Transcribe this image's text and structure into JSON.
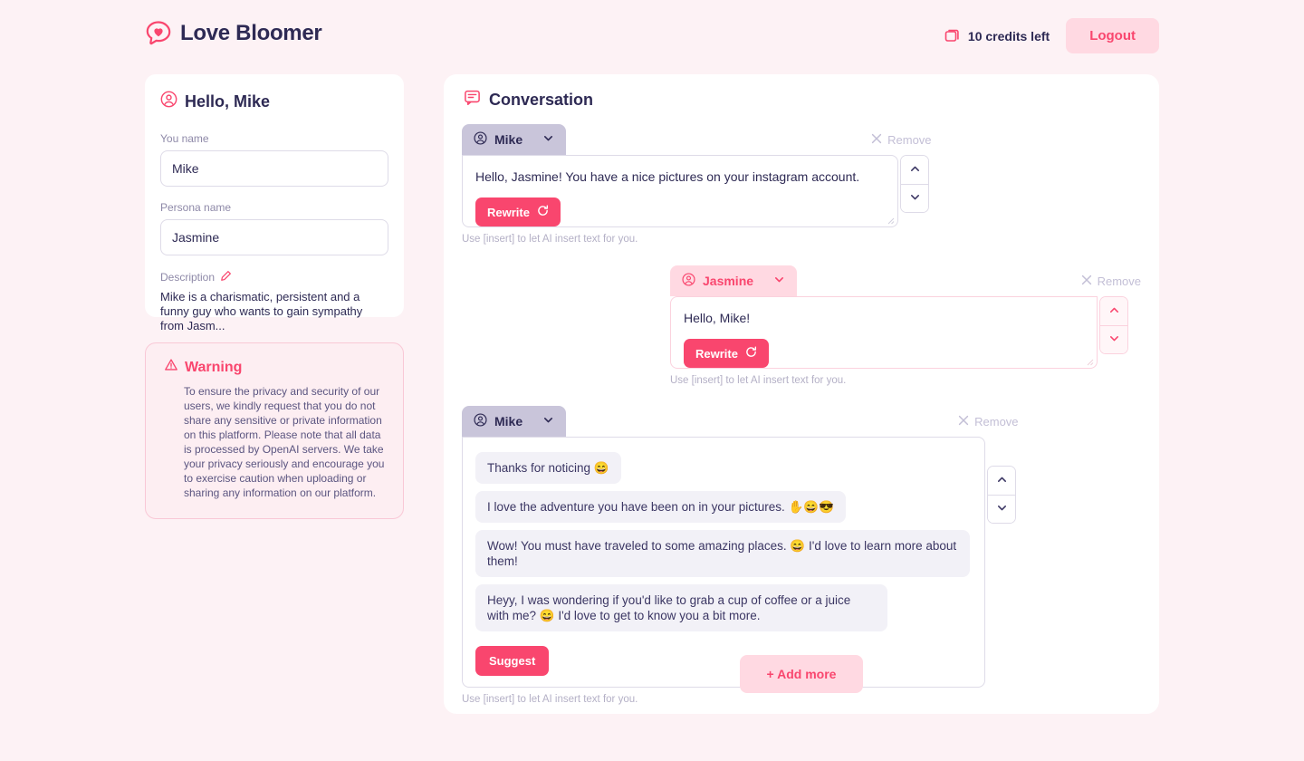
{
  "brand": {
    "name": "Love Bloomer",
    "logo_icon": "heart-speech-bubble-icon"
  },
  "header": {
    "credits_icon": "credits-card-icon",
    "credits_text": "10 credits left",
    "logout_label": "Logout"
  },
  "sidebar": {
    "profile": {
      "user_icon": "user-circle-icon",
      "greeting": "Hello, Mike",
      "you_name_label": "You name",
      "you_name_value": "Mike",
      "persona_name_label": "Persona name",
      "persona_name_value": "Jasmine",
      "description_label": "Description",
      "description_edit_icon": "pencil-icon",
      "description_value": "Mike is a charismatic, persistent and a funny guy who wants to gain sympathy from Jasm..."
    },
    "warning": {
      "icon": "alert-triangle-icon",
      "title": "Warning",
      "body": "To ensure the privacy and security of our users, we kindly request that you do not share any sensitive or private information on this platform. Please note that all data is processed by OpenAI servers. We take your privacy seriously and encourage you to exercise caution when uploading or sharing any information on our platform."
    }
  },
  "conversation": {
    "icon": "chat-bubble-icon",
    "title": "Conversation",
    "hint": "Use [insert] to let AI insert text for you.",
    "remove_label": "Remove",
    "remove_icon": "close-x-icon",
    "rewrite_label": "Rewrite",
    "rewrite_icon": "refresh-icon",
    "suggest_label": "Suggest",
    "caret_icon": "chevron-down-icon",
    "move_up_icon": "chevron-up-icon",
    "move_down_icon": "chevron-down-icon",
    "add_more_label": "+ Add more",
    "messages": [
      {
        "speaker": "Mike",
        "speaker_icon": "user-circle-icon",
        "text": "Hello, Jasmine! You have a nice pictures on your instagram account."
      },
      {
        "speaker": "Jasmine",
        "speaker_icon": "user-circle-icon",
        "text": "Hello, Mike!"
      },
      {
        "speaker": "Mike",
        "speaker_icon": "user-circle-icon",
        "suggestions": [
          "Thanks for noticing 😄",
          "I love the adventure you have been on in your pictures. ✋😄😎",
          "Wow! You must have traveled to some amazing places. 😄 I'd love to learn more about them!",
          "Heyy, I was wondering if you'd like to grab a cup of coffee or a juice with me? 😄 I'd love to get to know you a bit more."
        ]
      }
    ]
  },
  "colors": {
    "background": "#fdf2f5",
    "accent_pink": "#f9466e",
    "accent_pink_light": "#ffd9e2",
    "text_dark": "#2e2a54",
    "tab_lavender": "#c9c5da",
    "chip_bg": "#f2f1f7"
  }
}
